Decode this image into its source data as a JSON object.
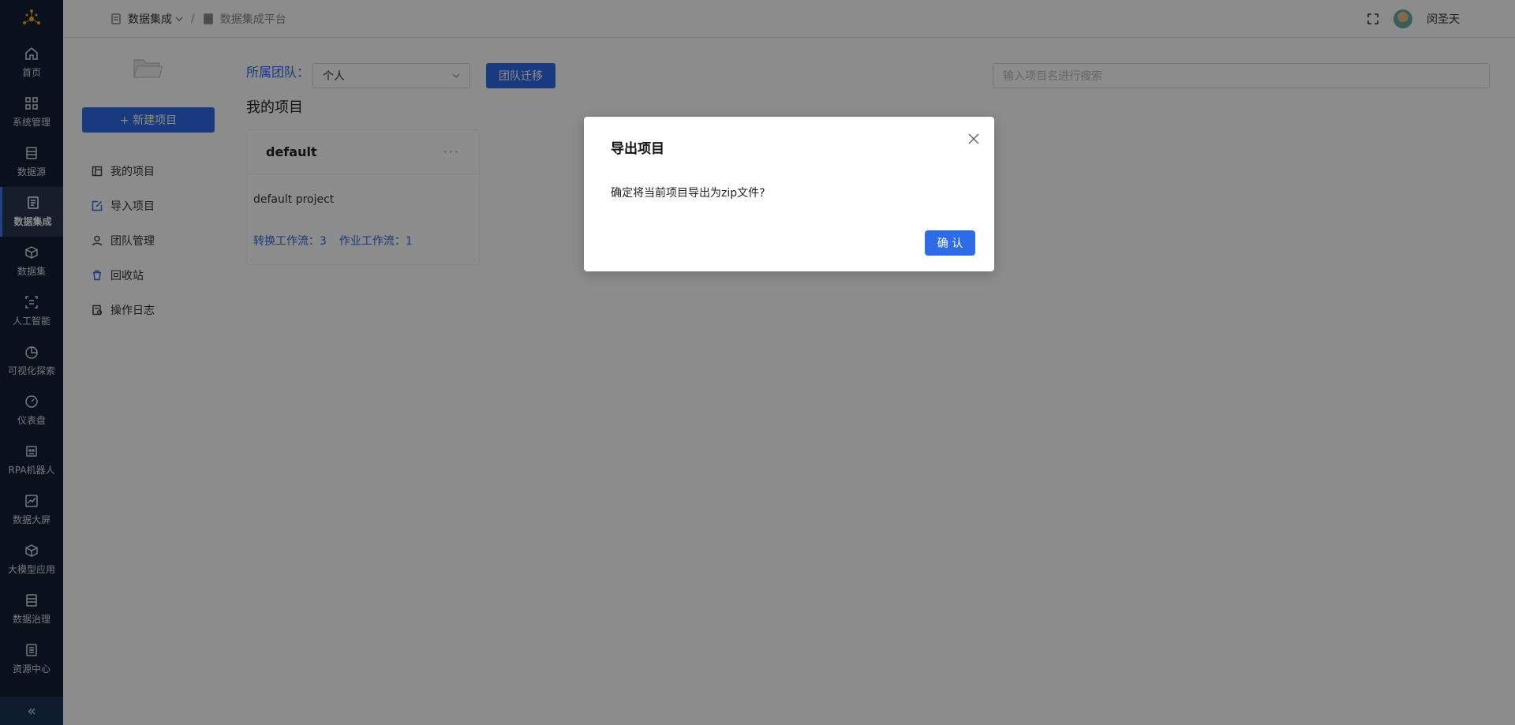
{
  "rail": {
    "items": [
      {
        "label": "首页",
        "icon": "home-icon"
      },
      {
        "label": "系统管理",
        "icon": "grid-icon"
      },
      {
        "label": "数据源",
        "icon": "database-icon"
      },
      {
        "label": "数据集成",
        "icon": "integration-icon"
      },
      {
        "label": "数据集",
        "icon": "cube-icon"
      },
      {
        "label": "人工智能",
        "icon": "ai-icon"
      },
      {
        "label": "可视化探索",
        "icon": "pie-icon"
      },
      {
        "label": "仪表盘",
        "icon": "gauge-icon"
      },
      {
        "label": "RPA机器人",
        "icon": "robot-icon"
      },
      {
        "label": "数据大屏",
        "icon": "screen-chart-icon"
      },
      {
        "label": "大模型应用",
        "icon": "model-cube-icon"
      },
      {
        "label": "数据治理",
        "icon": "governance-icon"
      },
      {
        "label": "资源中心",
        "icon": "resource-icon"
      }
    ],
    "active_index": 3,
    "collapse_glyph": "«"
  },
  "header": {
    "breadcrumb_module": "数据集成",
    "breadcrumb_sep": "/",
    "breadcrumb_page": "数据集成平台",
    "username": "闵圣天"
  },
  "sidebar": {
    "new_button": "+ 新建项目",
    "items": [
      {
        "label": "我的项目"
      },
      {
        "label": "导入项目"
      },
      {
        "label": "团队管理"
      },
      {
        "label": "回收站"
      },
      {
        "label": "操作日志"
      }
    ]
  },
  "main": {
    "team_label": "所属团队：",
    "team_value": "个人",
    "migrate_button": "团队迁移",
    "search_placeholder": "输入项目名进行搜索",
    "section_title": "我的项目",
    "card": {
      "name": "default",
      "more": "···",
      "description": "default project",
      "stat_transform": "转换工作流：3",
      "stat_job": "作业工作流：1"
    }
  },
  "modal": {
    "title": "导出项目",
    "message": "确定将当前项目导出为zip文件?",
    "ok_button": "确 认"
  },
  "colors": {
    "rail_bg": "#0f1f33",
    "primary": "#2e6be6"
  }
}
